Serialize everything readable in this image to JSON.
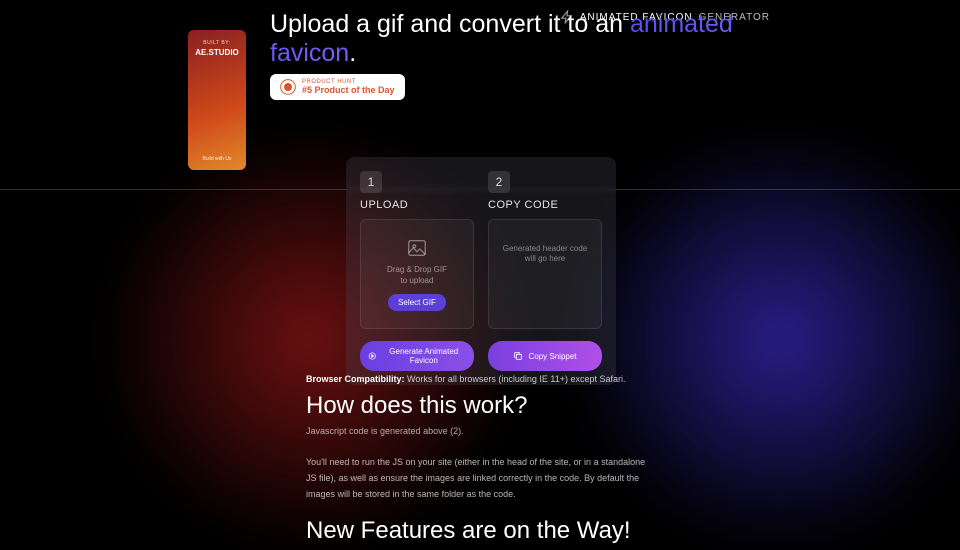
{
  "header": {
    "brand_strong": "ANIMATED FAVICON",
    "brand_light": "GENERATOR"
  },
  "sidebar": {
    "built_by": "BUILT BY:",
    "brand": "AE.STUDIO",
    "cta": "Build with Us"
  },
  "hero": {
    "title_pre": "Upload a gif and convert it to an ",
    "title_accent": "animated favicon",
    "title_post": "."
  },
  "product_hunt": {
    "label": "PRODUCT HUNT",
    "title": "#5 Product of the Day"
  },
  "panel": {
    "step1_num": "1",
    "step1_label": "UPLOAD",
    "upload_hint": "Drag & Drop GIF\nto upload",
    "select_btn": "Select GIF",
    "step2_num": "2",
    "step2_label": "COPY CODE",
    "code_hint": "Generated header code will go here",
    "generate_btn": "Generate Animated Favicon",
    "copy_btn": "Copy Snippet"
  },
  "content": {
    "compat_label": "Browser Compatibility:",
    "compat_text": " Works for all browsers (including IE 11+) except Safari.",
    "how_heading": "How does this work?",
    "how_sub": "Javascript code is generated above (2).",
    "how_para": "You'll need to run the JS on your site (either in the head of the site, or in a standalone JS file), as well as ensure the images are linked correctly in the code. By default the images will be stored in the same folder as the code.",
    "new_heading": "New Features are on the Way!"
  }
}
